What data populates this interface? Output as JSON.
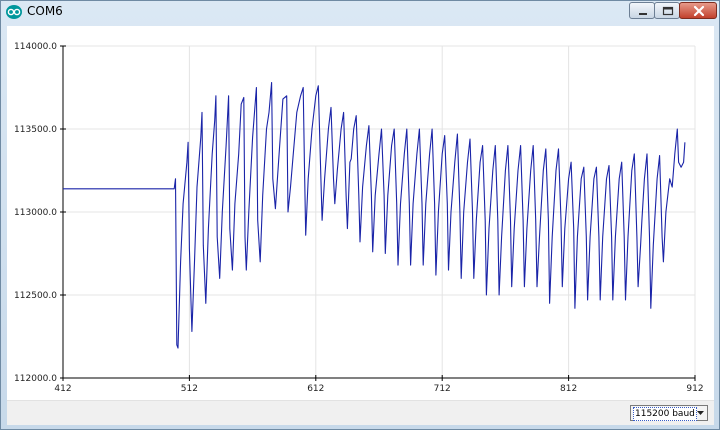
{
  "window": {
    "title": "COM6",
    "icons": {
      "app": "arduino-logo-icon",
      "minimize": "minimize-icon",
      "maximize": "maximize-icon",
      "close": "close-icon"
    }
  },
  "statusbar": {
    "baud_rate": "115200 baud",
    "dropdown_icon": "chevron-down-icon"
  },
  "colors": {
    "series": "#1a24a8",
    "grid": "#e4e4e4",
    "axis": "#000000"
  },
  "chart_data": {
    "type": "line",
    "xlim": [
      412,
      912
    ],
    "ylim": [
      112000,
      114000
    ],
    "x_ticks": [
      412,
      512,
      612,
      712,
      812,
      912
    ],
    "x_tick_labels": [
      "412",
      "512",
      "612",
      "712",
      "812",
      "912"
    ],
    "y_ticks": [
      112000,
      112500,
      113000,
      113500,
      114000
    ],
    "y_tick_labels": [
      "112000.0",
      "112500.0",
      "113000.0",
      "113500.0",
      "114000.0"
    ],
    "grid": true,
    "series": [
      {
        "points": [
          [
            412,
            113140
          ],
          [
            500,
            113140
          ],
          [
            501,
            113200
          ],
          [
            502,
            112200
          ],
          [
            503,
            112180
          ],
          [
            505,
            112700
          ],
          [
            507,
            113050
          ],
          [
            510,
            113300
          ],
          [
            511,
            113420
          ],
          [
            512,
            112780
          ],
          [
            514,
            112280
          ],
          [
            516,
            112700
          ],
          [
            518,
            113150
          ],
          [
            521,
            113450
          ],
          [
            522,
            113600
          ],
          [
            523,
            112800
          ],
          [
            525,
            112450
          ],
          [
            527,
            112900
          ],
          [
            530,
            113350
          ],
          [
            532,
            113550
          ],
          [
            533,
            113700
          ],
          [
            534,
            112850
          ],
          [
            536,
            112600
          ],
          [
            538,
            113000
          ],
          [
            541,
            113400
          ],
          [
            543,
            113700
          ],
          [
            544,
            112900
          ],
          [
            546,
            112650
          ],
          [
            548,
            113050
          ],
          [
            551,
            113350
          ],
          [
            553,
            113650
          ],
          [
            555,
            113690
          ],
          [
            556,
            112850
          ],
          [
            557,
            112650
          ],
          [
            559,
            113000
          ],
          [
            562,
            113450
          ],
          [
            565,
            113750
          ],
          [
            566,
            112950
          ],
          [
            568,
            112700
          ],
          [
            570,
            113100
          ],
          [
            573,
            113500
          ],
          [
            575,
            113600
          ],
          [
            577,
            113780
          ],
          [
            578,
            113200
          ],
          [
            580,
            113020
          ],
          [
            583,
            113350
          ],
          [
            586,
            113680
          ],
          [
            589,
            113700
          ],
          [
            590,
            113000
          ],
          [
            592,
            113150
          ],
          [
            594,
            113330
          ],
          [
            597,
            113600
          ],
          [
            600,
            113700
          ],
          [
            602,
            113750
          ],
          [
            603,
            113300
          ],
          [
            604,
            112860
          ],
          [
            606,
            113200
          ],
          [
            609,
            113500
          ],
          [
            612,
            113700
          ],
          [
            614,
            113760
          ],
          [
            616,
            113200
          ],
          [
            617,
            112950
          ],
          [
            619,
            113200
          ],
          [
            622,
            113500
          ],
          [
            624,
            113630
          ],
          [
            626,
            113200
          ],
          [
            627,
            113050
          ],
          [
            629,
            113250
          ],
          [
            632,
            113500
          ],
          [
            634,
            113600
          ],
          [
            636,
            113100
          ],
          [
            637,
            112900
          ],
          [
            639,
            113300
          ],
          [
            640,
            113320
          ],
          [
            642,
            113500
          ],
          [
            644,
            113580
          ],
          [
            646,
            113100
          ],
          [
            647,
            112820
          ],
          [
            649,
            113150
          ],
          [
            652,
            113400
          ],
          [
            654,
            113520
          ],
          [
            656,
            113100
          ],
          [
            657,
            112760
          ],
          [
            659,
            113100
          ],
          [
            662,
            113350
          ],
          [
            664,
            113500
          ],
          [
            666,
            113100
          ],
          [
            667,
            112750
          ],
          [
            669,
            113100
          ],
          [
            672,
            113400
          ],
          [
            674,
            113500
          ],
          [
            676,
            113050
          ],
          [
            677,
            112680
          ],
          [
            679,
            113050
          ],
          [
            682,
            113350
          ],
          [
            684,
            113500
          ],
          [
            686,
            113050
          ],
          [
            687,
            112680
          ],
          [
            689,
            113050
          ],
          [
            692,
            113350
          ],
          [
            694,
            113500
          ],
          [
            696,
            113050
          ],
          [
            697,
            112680
          ],
          [
            699,
            113050
          ],
          [
            702,
            113350
          ],
          [
            704,
            113500
          ],
          [
            706,
            113050
          ],
          [
            707,
            112620
          ],
          [
            709,
            113000
          ],
          [
            712,
            113350
          ],
          [
            714,
            113460
          ],
          [
            716,
            113050
          ],
          [
            717,
            112650
          ],
          [
            719,
            113000
          ],
          [
            722,
            113300
          ],
          [
            724,
            113470
          ],
          [
            726,
            113000
          ],
          [
            727,
            112600
          ],
          [
            729,
            113000
          ],
          [
            732,
            113300
          ],
          [
            734,
            113440
          ],
          [
            736,
            113000
          ],
          [
            737,
            112600
          ],
          [
            739,
            112950
          ],
          [
            742,
            113300
          ],
          [
            744,
            113400
          ],
          [
            746,
            112950
          ],
          [
            747,
            112500
          ],
          [
            749,
            112900
          ],
          [
            752,
            113250
          ],
          [
            754,
            113400
          ],
          [
            756,
            112950
          ],
          [
            757,
            112500
          ],
          [
            759,
            112850
          ],
          [
            762,
            113250
          ],
          [
            764,
            113400
          ],
          [
            766,
            112950
          ],
          [
            767,
            112550
          ],
          [
            769,
            112900
          ],
          [
            772,
            113250
          ],
          [
            774,
            113400
          ],
          [
            776,
            112950
          ],
          [
            777,
            112550
          ],
          [
            779,
            112900
          ],
          [
            782,
            113250
          ],
          [
            784,
            113400
          ],
          [
            786,
            112950
          ],
          [
            787,
            112550
          ],
          [
            789,
            112850
          ],
          [
            792,
            113250
          ],
          [
            794,
            113380
          ],
          [
            796,
            112950
          ],
          [
            797,
            112450
          ],
          [
            799,
            112850
          ],
          [
            802,
            113250
          ],
          [
            804,
            113380
          ],
          [
            806,
            112950
          ],
          [
            807,
            112550
          ],
          [
            809,
            112900
          ],
          [
            812,
            113200
          ],
          [
            814,
            113300
          ],
          [
            816,
            112900
          ],
          [
            817,
            112420
          ],
          [
            819,
            112850
          ],
          [
            822,
            113200
          ],
          [
            824,
            113270
          ],
          [
            826,
            112850
          ],
          [
            827,
            112470
          ],
          [
            829,
            112850
          ],
          [
            832,
            113200
          ],
          [
            834,
            113270
          ],
          [
            836,
            112850
          ],
          [
            837,
            112470
          ],
          [
            839,
            112850
          ],
          [
            842,
            113200
          ],
          [
            844,
            113280
          ],
          [
            846,
            112850
          ],
          [
            847,
            112470
          ],
          [
            849,
            112850
          ],
          [
            852,
            113200
          ],
          [
            854,
            113300
          ],
          [
            856,
            112850
          ],
          [
            857,
            112470
          ],
          [
            859,
            112850
          ],
          [
            862,
            113250
          ],
          [
            864,
            113350
          ],
          [
            866,
            112850
          ],
          [
            867,
            112550
          ],
          [
            869,
            112800
          ],
          [
            870,
            112950
          ],
          [
            872,
            113200
          ],
          [
            874,
            113350
          ],
          [
            876,
            112850
          ],
          [
            877,
            112420
          ],
          [
            879,
            112800
          ],
          [
            882,
            113200
          ],
          [
            884,
            113340
          ],
          [
            886,
            112850
          ],
          [
            887,
            112700
          ],
          [
            889,
            113000
          ],
          [
            892,
            113200
          ],
          [
            894,
            113150
          ],
          [
            896,
            113350
          ],
          [
            898,
            113500
          ],
          [
            899,
            113300
          ],
          [
            901,
            113270
          ],
          [
            903,
            113300
          ],
          [
            904,
            113420
          ]
        ]
      }
    ]
  }
}
